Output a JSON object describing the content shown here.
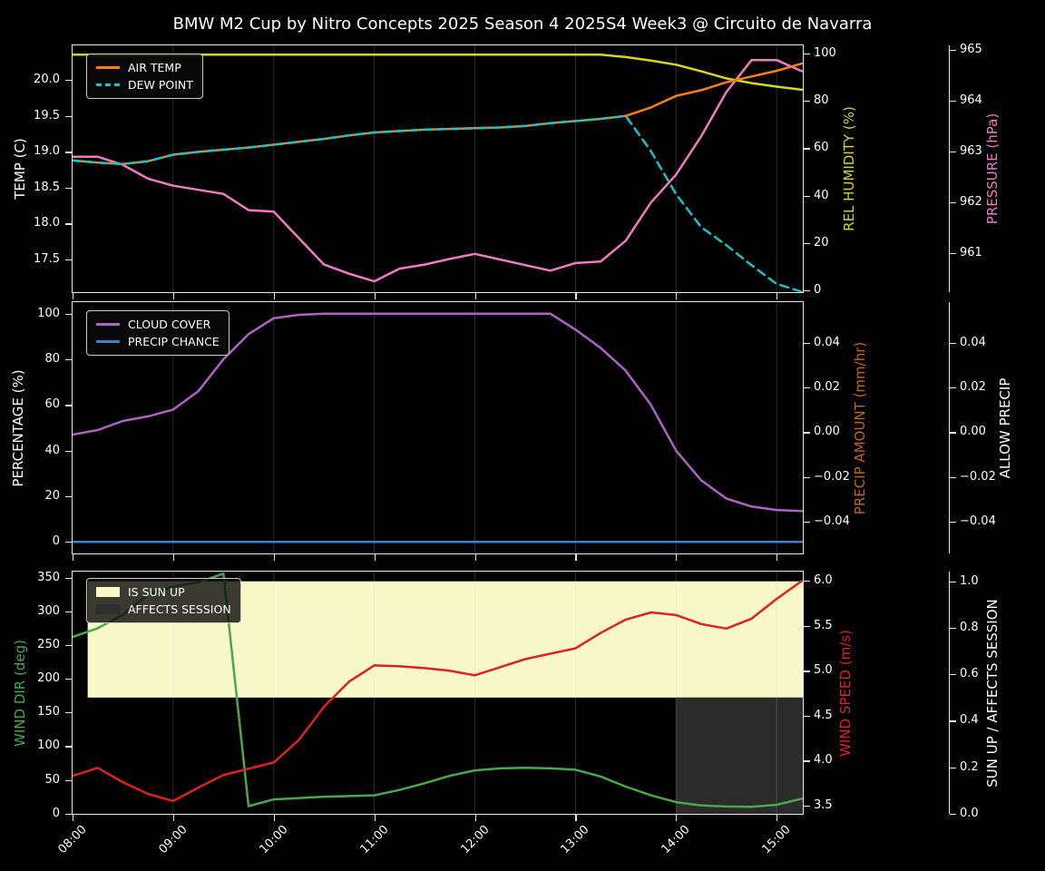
{
  "title": "BMW M2 Cup by Nitro Concepts 2025 Season 4 2025S4 Week3 @ Circuito de Navarra",
  "x_ticks": {
    "hours": [
      8,
      9,
      10,
      11,
      12,
      13,
      14,
      15
    ],
    "labels": [
      "08:00",
      "09:00",
      "10:00",
      "11:00",
      "12:00",
      "13:00",
      "14:00",
      "15:00"
    ]
  },
  "chart_data": [
    {
      "id": "temperature-panel",
      "type": "line",
      "xlim_hours": [
        8,
        15.26
      ],
      "x_hours": [
        8.0,
        8.25,
        8.5,
        8.75,
        9.0,
        9.25,
        9.5,
        9.75,
        10.0,
        10.25,
        10.5,
        10.75,
        11.0,
        11.25,
        11.5,
        11.75,
        12.0,
        12.25,
        12.5,
        12.75,
        13.0,
        13.25,
        13.5,
        13.75,
        14.0,
        14.25,
        14.5,
        14.75,
        15.0,
        15.25
      ],
      "series": [
        {
          "name": "REL HUMIDITY",
          "scale": "hum",
          "color": "#d6d621",
          "dashed": false,
          "values": [
            99.5,
            99.5,
            99.5,
            99.5,
            99.5,
            99.5,
            99.5,
            99.5,
            99.5,
            99.5,
            99.5,
            99.5,
            99.5,
            99.5,
            99.5,
            99.5,
            99.5,
            99.5,
            99.5,
            99.5,
            99.5,
            99.5,
            98.5,
            97.0,
            95.3,
            92.5,
            89.5,
            87.5,
            86.0,
            84.7
          ]
        },
        {
          "name": "PRESSURE",
          "scale": "press",
          "color": "#f07bc2",
          "dashed": false,
          "values": [
            962.9,
            962.9,
            962.74,
            962.47,
            962.33,
            962.25,
            962.17,
            961.85,
            961.82,
            961.3,
            960.78,
            960.6,
            960.45,
            960.7,
            960.78,
            960.89,
            960.99,
            960.88,
            960.77,
            960.66,
            960.81,
            960.84,
            961.25,
            962.0,
            962.55,
            963.3,
            964.17,
            964.8,
            964.8,
            964.58
          ]
        },
        {
          "name": "AIR TEMP",
          "scale": "temp",
          "color": "#ff7f0e",
          "dashed": false,
          "values": [
            18.88,
            18.85,
            18.83,
            18.87,
            18.96,
            19.0,
            19.03,
            19.06,
            19.1,
            19.14,
            19.18,
            19.23,
            19.27,
            19.29,
            19.31,
            19.32,
            19.33,
            19.34,
            19.36,
            19.4,
            19.43,
            19.46,
            19.5,
            19.62,
            19.78,
            19.86,
            19.97,
            20.05,
            20.13,
            20.23
          ]
        },
        {
          "name": "DEW POINT",
          "scale": "temp",
          "color": "#17c4c8",
          "dashed": true,
          "values": [
            18.88,
            18.85,
            18.83,
            18.87,
            18.96,
            19.0,
            19.03,
            19.06,
            19.1,
            19.14,
            19.18,
            19.23,
            19.27,
            19.29,
            19.31,
            19.32,
            19.33,
            19.34,
            19.36,
            19.4,
            19.43,
            19.46,
            19.5,
            19.01,
            18.41,
            17.95,
            17.7,
            17.42,
            17.16,
            17.05
          ]
        }
      ],
      "legend": [
        {
          "label": "AIR TEMP",
          "type": "line",
          "color": "#ff7f0e"
        },
        {
          "label": "DEW POINT",
          "type": "dashed-line",
          "color": "#17c4c8"
        }
      ],
      "axes": {
        "left": {
          "title": "TEMP (C)",
          "color": "#ffffff",
          "scale": "temp",
          "values": [
            17.5,
            18.0,
            18.5,
            19.0,
            19.5,
            20.0
          ],
          "labels": [
            "17.5",
            "18.0",
            "18.5",
            "19.0",
            "19.5",
            "20.0"
          ]
        },
        "right_inner": {
          "title": "REL HUMIDITY (%)",
          "color": "#d6d621",
          "scale": "hum",
          "values": [
            0,
            20,
            40,
            60,
            80,
            100
          ],
          "labels": [
            "0",
            "20",
            "40",
            "60",
            "80",
            "100"
          ]
        },
        "right_outer": {
          "title": "PRESSURE (hPa)",
          "color": "#f07bc2",
          "scale": "press",
          "values": [
            961,
            962,
            963,
            964,
            965
          ],
          "labels": [
            "961",
            "962",
            "963",
            "964",
            "965"
          ]
        }
      }
    },
    {
      "id": "precip-panel",
      "type": "line",
      "xlim_hours": [
        8,
        15.26
      ],
      "x_hours": [
        8.0,
        8.25,
        8.5,
        8.75,
        9.0,
        9.25,
        9.5,
        9.75,
        10.0,
        10.25,
        10.5,
        10.75,
        11.0,
        11.25,
        11.5,
        11.75,
        12.0,
        12.25,
        12.5,
        12.75,
        13.0,
        13.25,
        13.5,
        13.75,
        14.0,
        14.25,
        14.5,
        14.75,
        15.0,
        15.25
      ],
      "series": [
        {
          "name": "CLOUD COVER",
          "scale": "pct",
          "color": "#ad62c6",
          "dashed": false,
          "values": [
            47,
            49,
            53,
            55,
            58,
            66,
            80,
            91,
            98,
            99.5,
            100,
            100,
            100,
            100,
            100,
            100,
            100,
            100,
            100,
            100,
            93,
            85,
            75,
            60,
            40,
            27,
            19,
            15.5,
            14,
            13.5
          ]
        },
        {
          "name": "PRECIP CHANCE",
          "scale": "pct",
          "color": "#3f83c4",
          "dashed": false,
          "values": [
            0,
            0,
            0,
            0,
            0,
            0,
            0,
            0,
            0,
            0,
            0,
            0,
            0,
            0,
            0,
            0,
            0,
            0,
            0,
            0,
            0,
            0,
            0,
            0,
            0,
            0,
            0,
            0,
            0,
            0
          ]
        }
      ],
      "legend": [
        {
          "label": "CLOUD COVER",
          "type": "line",
          "color": "#ad62c6"
        },
        {
          "label": "PRECIP CHANCE",
          "type": "line",
          "color": "#3f83c4"
        }
      ],
      "axes": {
        "left": {
          "title": "PERCENTAGE (%)",
          "color": "#ffffff",
          "scale": "pct",
          "values": [
            0,
            20,
            40,
            60,
            80,
            100
          ],
          "labels": [
            "0",
            "20",
            "40",
            "60",
            "80",
            "100"
          ]
        },
        "right_inner": {
          "title": "PRECIP AMOUNT (mm/hr)",
          "color": "#bf671f",
          "scale": "pamt",
          "values": [
            0.04,
            0.02,
            0,
            -0.02,
            -0.04
          ],
          "labels": [
            "0.04",
            "0.02",
            "0.00",
            "−0.02",
            "−0.04"
          ]
        },
        "right_outer": {
          "title": "ALLOW PRECIP",
          "color": "#ffffff",
          "scale": "pamt",
          "values": [
            0.04,
            0.02,
            0,
            -0.02,
            -0.04
          ],
          "labels": [
            "0.04",
            "0.02",
            "0.00",
            "−0.02",
            "−0.04"
          ]
        }
      }
    },
    {
      "id": "wind-panel",
      "type": "line",
      "xlim_hours": [
        8,
        15.26
      ],
      "x_hours": [
        8.0,
        8.25,
        8.5,
        8.75,
        9.0,
        9.25,
        9.5,
        9.75,
        10.0,
        10.25,
        10.5,
        10.75,
        11.0,
        11.25,
        11.5,
        11.75,
        12.0,
        12.25,
        12.5,
        12.75,
        13.0,
        13.25,
        13.5,
        13.75,
        14.0,
        14.25,
        14.5,
        14.75,
        15.0,
        15.25
      ],
      "bands": [
        {
          "label": "IS SUN UP",
          "color": "#f8f8c9",
          "x_from": 8.15,
          "x_to": 15.26,
          "v_from": 0.5,
          "v_to": 1.0,
          "scale": "sun"
        },
        {
          "label": "AFFECTS SESSION",
          "color": "#2b2b2b",
          "x_from": 14.0,
          "x_to": 15.26,
          "v_from": 0.0,
          "v_to": 0.5,
          "scale": "sun"
        }
      ],
      "series": [
        {
          "name": "WIND DIR",
          "scale": "dir",
          "color": "#49a849",
          "dashed": false,
          "values": [
            262,
            275,
            295,
            325,
            337,
            343,
            356,
            11,
            21,
            23,
            25,
            26,
            27,
            35,
            45,
            56,
            64,
            67,
            68,
            67,
            65,
            55,
            40,
            27,
            17,
            12,
            10.5,
            10,
            13,
            22
          ]
        },
        {
          "name": "WIND SPEED",
          "scale": "spd",
          "color": "#dd2222",
          "dashed": false,
          "values": [
            3.83,
            3.92,
            3.76,
            3.63,
            3.55,
            3.7,
            3.84,
            3.91,
            3.98,
            4.23,
            4.6,
            4.88,
            5.06,
            5.05,
            5.03,
            5.0,
            4.95,
            5.04,
            5.13,
            5.19,
            5.25,
            5.42,
            5.57,
            5.65,
            5.62,
            5.52,
            5.47,
            5.58,
            5.8,
            6.0
          ]
        }
      ],
      "legend": [
        {
          "label": "IS SUN UP",
          "type": "patch",
          "color": "#f8f8c9"
        },
        {
          "label": "AFFECTS SESSION",
          "type": "patch",
          "color": "#2f2f2f"
        }
      ],
      "axes": {
        "left": {
          "title": "WIND DIR (deg)",
          "color": "#49a849",
          "scale": "dir",
          "values": [
            0,
            50,
            100,
            150,
            200,
            250,
            300,
            350
          ],
          "labels": [
            "0",
            "50",
            "100",
            "150",
            "200",
            "250",
            "300",
            "350"
          ]
        },
        "right_inner": {
          "title": "WIND SPEED (m/s)",
          "color": "#dd2222",
          "scale": "spd",
          "values": [
            3.5,
            4.0,
            4.5,
            5.0,
            5.5,
            6.0
          ],
          "labels": [
            "3.5",
            "4.0",
            "4.5",
            "5.0",
            "5.5",
            "6.0"
          ]
        },
        "right_outer": {
          "title": "SUN UP / AFFECTS SESSION",
          "color": "#ffffff",
          "scale": "sun",
          "values": [
            0,
            0.2,
            0.4,
            0.6,
            0.8,
            1.0
          ],
          "labels": [
            "0.0",
            "0.2",
            "0.4",
            "0.6",
            "0.8",
            "1.0"
          ]
        }
      }
    }
  ]
}
